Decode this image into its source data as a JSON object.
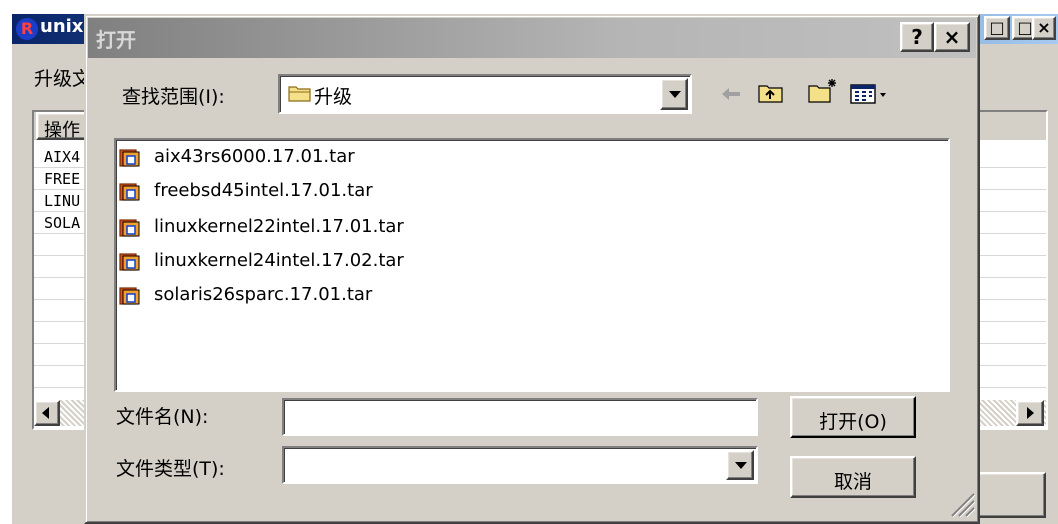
{
  "background_window": {
    "title": "unix",
    "menu_item": "升级文",
    "column_header": "操作",
    "rows": [
      "AIX4",
      "FREE",
      "LINU",
      "SOLA"
    ]
  },
  "dialog": {
    "title": "打开",
    "help_label": "?",
    "close_label": "×",
    "look_in_label": "查找范围(I):",
    "look_in_value": "升级",
    "files": [
      "aix43rs6000.17.01.tar",
      "freebsd45intel.17.01.tar",
      "linuxkernel22intel.17.01.tar",
      "linuxkernel24intel.17.02.tar",
      "solaris26sparc.17.01.tar"
    ],
    "filename_label": "文件名(N):",
    "filename_value": "",
    "filetype_label": "文件类型(T):",
    "filetype_value": "",
    "open_button": "打开(O)",
    "cancel_button": "取消"
  },
  "icons": {
    "back": "back-arrow-icon",
    "up": "up-folder-icon",
    "new_folder": "new-folder-icon",
    "view_menu": "view-menu-icon",
    "file": "archive-file-icon",
    "folder": "folder-icon"
  }
}
